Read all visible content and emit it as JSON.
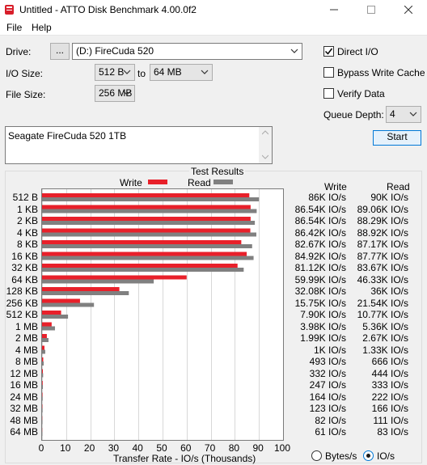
{
  "window": {
    "title": "Untitled - ATTO Disk Benchmark 4.00.0f2",
    "minimize": "—",
    "maximize": "☐",
    "close": "✕"
  },
  "menu": {
    "file": "File",
    "help": "Help"
  },
  "drive": {
    "label": "Drive:",
    "browse": "...",
    "value": "(D:) FireCuda 520"
  },
  "io_size": {
    "label": "I/O Size:",
    "from": "512 B",
    "to_label": "to",
    "to": "64 MB"
  },
  "file_size": {
    "label": "File Size:",
    "value": "256 MB"
  },
  "options": {
    "direct_io": {
      "label": "Direct I/O",
      "checked": true
    },
    "bypass_write_cache": {
      "label": "Bypass Write Cache",
      "checked": false
    },
    "verify_data": {
      "label": "Verify Data",
      "checked": false
    },
    "queue_depth_label": "Queue Depth:",
    "queue_depth": "4"
  },
  "start_button": "Start",
  "description": "Seagate FireCuda 520 1TB",
  "results": {
    "group_title": "Test Results",
    "legend_write": "Write",
    "legend_read": "Read",
    "col_write": "Write",
    "col_read": "Read",
    "write_color": "#e8202a",
    "read_color": "#808080",
    "rows": [
      {
        "size": "512 B",
        "write": "86K IO/s",
        "read": "90K IO/s"
      },
      {
        "size": "1 KB",
        "write": "86.54K IO/s",
        "read": "89.06K IO/s"
      },
      {
        "size": "2 KB",
        "write": "86.54K IO/s",
        "read": "88.29K IO/s"
      },
      {
        "size": "4 KB",
        "write": "86.42K IO/s",
        "read": "88.92K IO/s"
      },
      {
        "size": "8 KB",
        "write": "82.67K IO/s",
        "read": "87.17K IO/s"
      },
      {
        "size": "16 KB",
        "write": "84.92K IO/s",
        "read": "87.77K IO/s"
      },
      {
        "size": "32 KB",
        "write": "81.12K IO/s",
        "read": "83.67K IO/s"
      },
      {
        "size": "64 KB",
        "write": "59.99K IO/s",
        "read": "46.33K IO/s"
      },
      {
        "size": "128 KB",
        "write": "32.08K IO/s",
        "read": "36K IO/s"
      },
      {
        "size": "256 KB",
        "write": "15.75K IO/s",
        "read": "21.54K IO/s"
      },
      {
        "size": "512 KB",
        "write": "7.90K IO/s",
        "read": "10.77K IO/s"
      },
      {
        "size": "1 MB",
        "write": "3.98K IO/s",
        "read": "5.36K IO/s"
      },
      {
        "size": "2 MB",
        "write": "1.99K IO/s",
        "read": "2.67K IO/s"
      },
      {
        "size": "4 MB",
        "write": "1K IO/s",
        "read": "1.33K IO/s"
      },
      {
        "size": "8 MB",
        "write": "493 IO/s",
        "read": "666 IO/s"
      },
      {
        "size": "12 MB",
        "write": "332 IO/s",
        "read": "444 IO/s"
      },
      {
        "size": "16 MB",
        "write": "247 IO/s",
        "read": "333 IO/s"
      },
      {
        "size": "24 MB",
        "write": "164 IO/s",
        "read": "222 IO/s"
      },
      {
        "size": "32 MB",
        "write": "123 IO/s",
        "read": "166 IO/s"
      },
      {
        "size": "48 MB",
        "write": "82 IO/s",
        "read": "111 IO/s"
      },
      {
        "size": "64 MB",
        "write": "61 IO/s",
        "read": "83 IO/s"
      }
    ],
    "xlabel": "Transfer Rate - IO/s (Thousands)",
    "radio_bytes": "Bytes/s",
    "radio_ios": "IO/s",
    "radio_ios_selected": true
  },
  "chart_data": {
    "type": "bar",
    "orientation": "horizontal",
    "categories": [
      "512 B",
      "1 KB",
      "2 KB",
      "4 KB",
      "8 KB",
      "16 KB",
      "32 KB",
      "64 KB",
      "128 KB",
      "256 KB",
      "512 KB",
      "1 MB",
      "2 MB",
      "4 MB",
      "8 MB",
      "12 MB",
      "16 MB",
      "24 MB",
      "32 MB",
      "48 MB",
      "64 MB"
    ],
    "series": [
      {
        "name": "Write",
        "color": "#e8202a",
        "values": [
          86,
          86.54,
          86.54,
          86.42,
          82.67,
          84.92,
          81.12,
          59.99,
          32.08,
          15.75,
          7.9,
          3.98,
          1.99,
          1,
          0.493,
          0.332,
          0.247,
          0.164,
          0.123,
          0.082,
          0.061
        ]
      },
      {
        "name": "Read",
        "color": "#808080",
        "values": [
          90,
          89.06,
          88.29,
          88.92,
          87.17,
          87.77,
          83.67,
          46.33,
          36,
          21.54,
          10.77,
          5.36,
          2.67,
          1.33,
          0.666,
          0.444,
          0.333,
          0.222,
          0.166,
          0.111,
          0.083
        ]
      }
    ],
    "title": "Test Results",
    "xlabel": "Transfer Rate - IO/s (Thousands)",
    "xlim": [
      0,
      100
    ],
    "xticks": [
      "0",
      "10",
      "20",
      "30",
      "40",
      "50",
      "60",
      "70",
      "80",
      "90",
      "100"
    ],
    "grid": true,
    "legend": "top"
  }
}
